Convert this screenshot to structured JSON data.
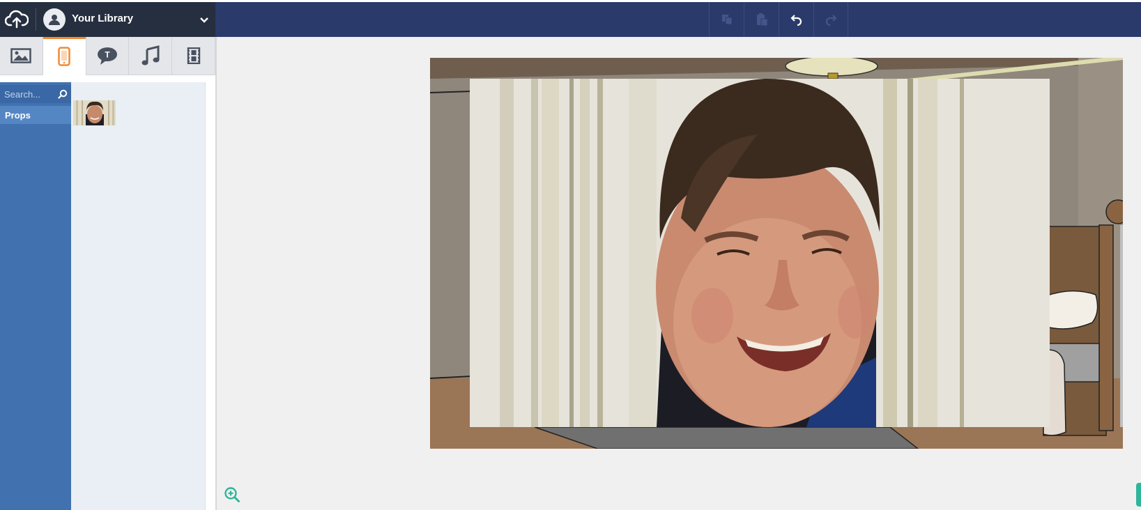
{
  "header": {
    "library_title": "Your Library",
    "icons": {
      "upload": "cloud-upload-icon",
      "avatar": "user-icon",
      "dropdown": "chevron-down-icon"
    }
  },
  "toolbar": {
    "items": [
      {
        "name": "copy-button",
        "icon": "copy-icon",
        "enabled": false
      },
      {
        "name": "paste-button",
        "icon": "paste-icon",
        "enabled": false
      },
      {
        "name": "undo-button",
        "icon": "undo-icon",
        "enabled": true
      },
      {
        "name": "redo-button",
        "icon": "redo-icon",
        "enabled": false
      }
    ]
  },
  "tabs": [
    {
      "name": "tab-backgrounds",
      "icon": "image-icon",
      "active": false
    },
    {
      "name": "tab-props",
      "icon": "phone-icon",
      "active": true
    },
    {
      "name": "tab-text",
      "icon": "speech-bubble-icon",
      "active": false
    },
    {
      "name": "tab-sound",
      "icon": "music-note-icon",
      "active": false
    },
    {
      "name": "tab-video",
      "icon": "film-icon",
      "active": false
    }
  ],
  "sidebar": {
    "search_placeholder": "Search...",
    "categories": [
      {
        "label": "Props",
        "selected": true
      }
    ]
  },
  "colors": {
    "header_bg": "#2a3a6a",
    "library_bg": "#262f3f",
    "accent_orange": "#f08a30",
    "sidebar_blue": "#4271b0",
    "selected_blue": "#5486c4",
    "teal": "#2fb59a"
  }
}
